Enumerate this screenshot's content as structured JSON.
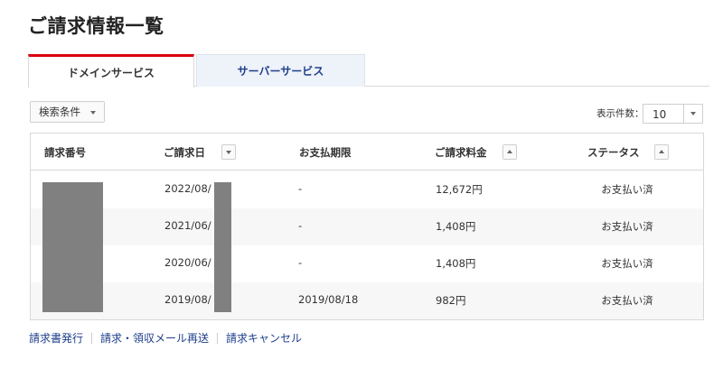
{
  "title": "ご請求情報一覧",
  "tabs": [
    {
      "label": "ドメインサービス",
      "active": true
    },
    {
      "label": "サーバーサービス",
      "active": false
    }
  ],
  "filter": {
    "label": "検索条件"
  },
  "count": {
    "label": "表示件数：",
    "value": "10"
  },
  "table": {
    "headers": {
      "invoice_no": "請求番号",
      "invoice_date": "ご請求日",
      "due_date": "お支払期限",
      "amount": "ご請求料金",
      "status": "ステータス"
    },
    "rows": [
      {
        "date": "2022/08/",
        "due": "-",
        "amount": "12,672円",
        "status": "お支払い済"
      },
      {
        "date": "2021/06/",
        "due": "-",
        "amount": "1,408円",
        "status": "お支払い済"
      },
      {
        "date": "2020/06/",
        "due": "-",
        "amount": "1,408円",
        "status": "お支払い済"
      },
      {
        "date": "2019/08/",
        "due": "2019/08/18",
        "amount": "982円",
        "status": "お支払い済"
      }
    ]
  },
  "footer": {
    "links": [
      "請求書発行",
      "請求・領収メール再送",
      "請求キャンセル"
    ]
  },
  "colors": {
    "accent": "#d9000d",
    "link": "#1e3f8c",
    "redaction": "#808080"
  }
}
